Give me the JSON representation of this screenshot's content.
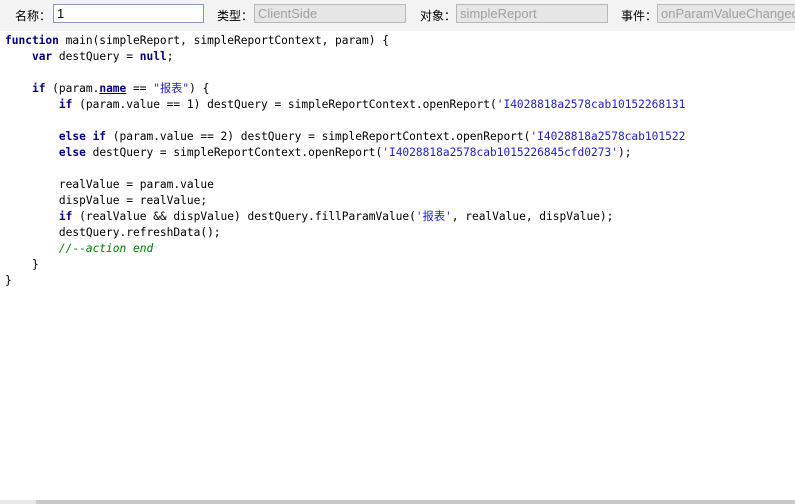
{
  "toolbar": {
    "name_label": "名称：",
    "name_value": "1",
    "type_label": "类型：",
    "type_value": "ClientSide",
    "object_label": "对象：",
    "object_value": "simpleReport",
    "event_label": "事件：",
    "event_value": "onParamValueChanged"
  },
  "code": {
    "lines": [
      [
        {
          "t": "kw",
          "v": "function"
        },
        {
          "t": "",
          "v": " main(simpleReport, simpleReportContext, param) {"
        }
      ],
      [
        {
          "t": "",
          "v": "    "
        },
        {
          "t": "kw",
          "v": "var"
        },
        {
          "t": "",
          "v": " destQuery = "
        },
        {
          "t": "kw",
          "v": "null"
        },
        {
          "t": "",
          "v": ";"
        }
      ],
      [],
      [
        {
          "t": "",
          "v": "    "
        },
        {
          "t": "kw",
          "v": "if"
        },
        {
          "t": "",
          "v": " (param."
        },
        {
          "t": "prop",
          "v": "name"
        },
        {
          "t": "",
          "v": " == "
        },
        {
          "t": "str",
          "v": "\"报表\""
        },
        {
          "t": "",
          "v": ") {"
        }
      ],
      [
        {
          "t": "",
          "v": "        "
        },
        {
          "t": "kw",
          "v": "if"
        },
        {
          "t": "",
          "v": " (param.value == 1) destQuery = simpleReportContext.openReport("
        },
        {
          "t": "str",
          "v": "'I4028818a2578cab10152268131"
        }
      ],
      [],
      [
        {
          "t": "",
          "v": "        "
        },
        {
          "t": "kw",
          "v": "else if"
        },
        {
          "t": "",
          "v": " (param.value == 2) destQuery = simpleReportContext.openReport("
        },
        {
          "t": "str",
          "v": "'I4028818a2578cab101522"
        }
      ],
      [
        {
          "t": "",
          "v": "        "
        },
        {
          "t": "kw",
          "v": "else"
        },
        {
          "t": "",
          "v": " destQuery = simpleReportContext.openReport("
        },
        {
          "t": "str",
          "v": "'I4028818a2578cab1015226845cfd0273'"
        },
        {
          "t": "",
          "v": ");"
        }
      ],
      [],
      [
        {
          "t": "",
          "v": "        realValue = param.value"
        }
      ],
      [
        {
          "t": "",
          "v": "        dispValue = realValue;"
        }
      ],
      [
        {
          "t": "",
          "v": "        "
        },
        {
          "t": "kw",
          "v": "if"
        },
        {
          "t": "",
          "v": " (realValue && dispValue) destQuery.fillParamValue("
        },
        {
          "t": "str",
          "v": "'报表'"
        },
        {
          "t": "",
          "v": ", realValue, dispValue);"
        }
      ],
      [
        {
          "t": "",
          "v": "        destQuery.refreshData();"
        }
      ],
      [
        {
          "t": "",
          "v": "        "
        },
        {
          "t": "cmt",
          "v": "//--action end"
        }
      ],
      [
        {
          "t": "",
          "v": "    }"
        }
      ],
      [
        {
          "t": "",
          "v": "}"
        }
      ]
    ]
  }
}
